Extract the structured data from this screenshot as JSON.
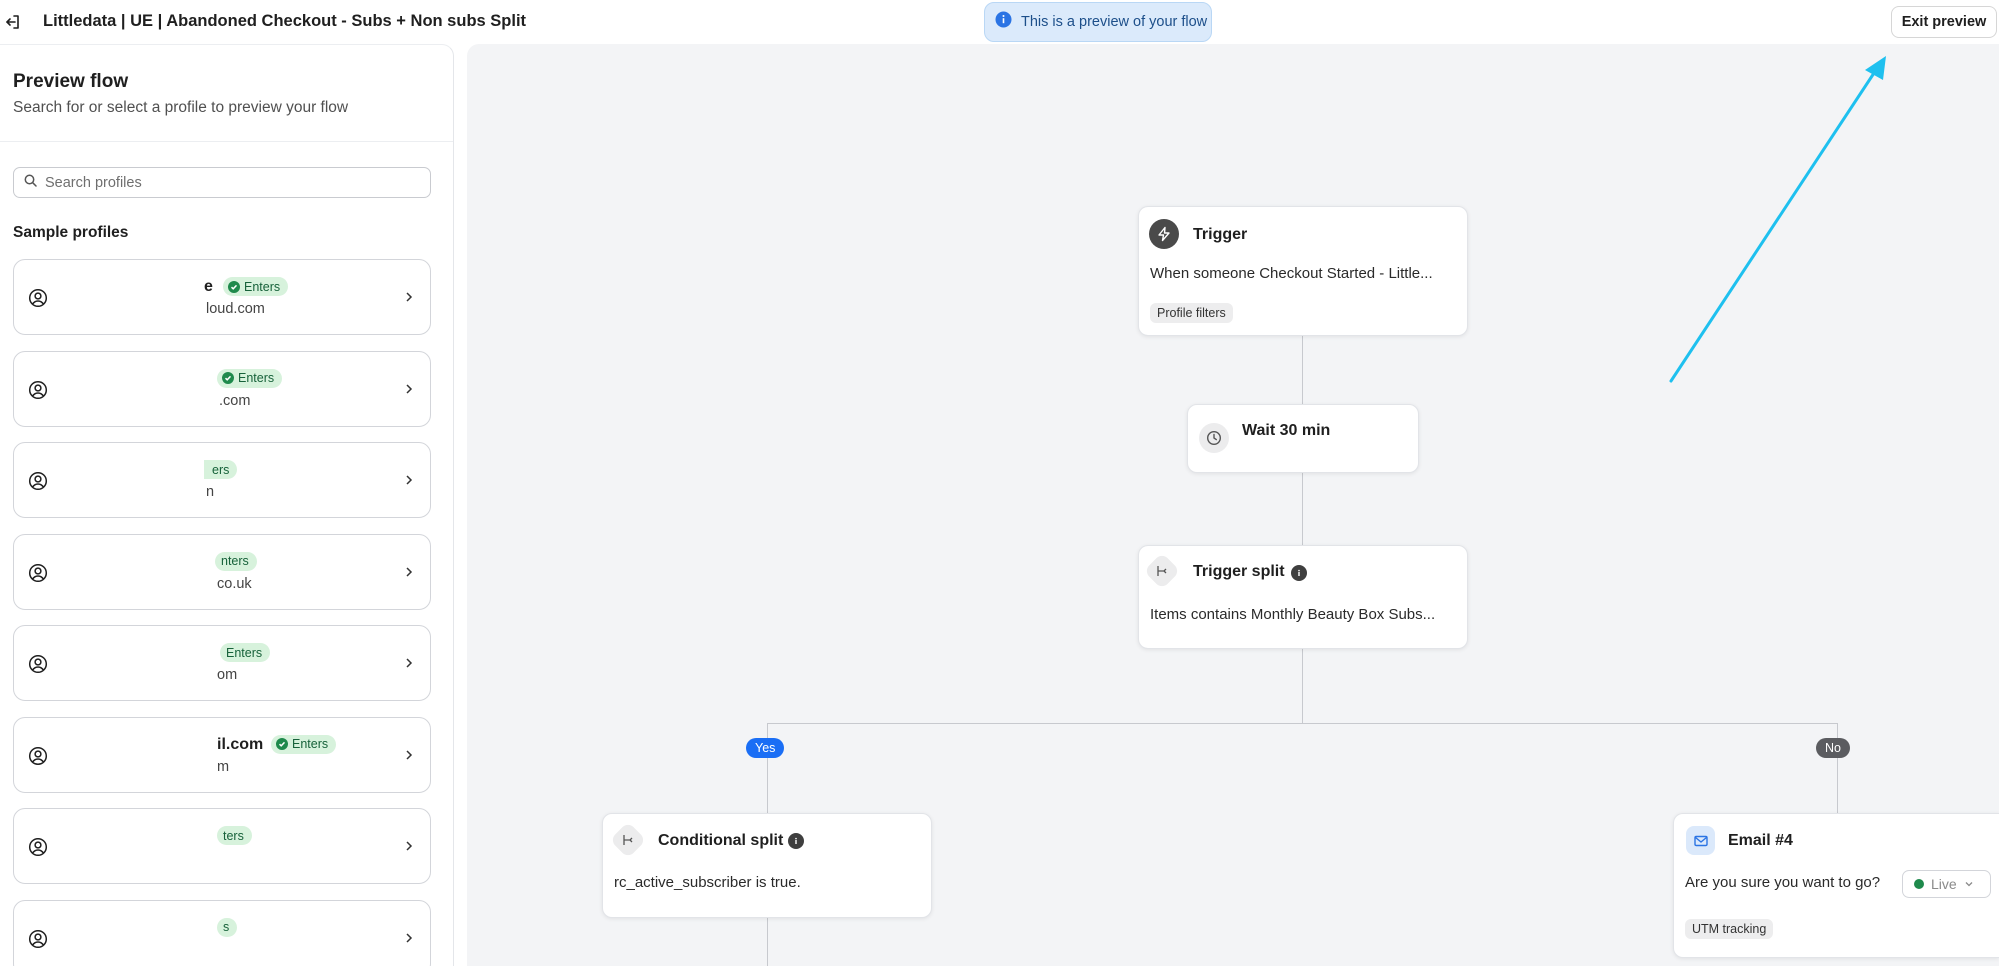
{
  "header": {
    "title": "Littledata | UE | Abandoned Checkout - Subs + Non subs Split",
    "preview_banner": "This is a preview of your flow",
    "exit_button": "Exit preview"
  },
  "sidebar": {
    "title": "Preview flow",
    "subtitle": "Search for or select a profile to preview your flow",
    "search_placeholder": "Search profiles",
    "sample_heading": "Sample profiles",
    "profiles": [
      {
        "name": "e",
        "email": "loud.com",
        "badge": "Enters"
      },
      {
        "name": "",
        "email": ".com",
        "badge": "Enters"
      },
      {
        "name": "",
        "email": "n",
        "badge": "ers"
      },
      {
        "name": "",
        "email": "co.uk",
        "badge": "nters"
      },
      {
        "name": "",
        "email": "om",
        "badge": "Enters"
      },
      {
        "name": "il.com",
        "email": "m",
        "badge": "Enters"
      },
      {
        "name": "",
        "email": "",
        "badge": "ters"
      },
      {
        "name": "",
        "email": "",
        "badge": "s"
      }
    ]
  },
  "flow": {
    "trigger": {
      "title": "Trigger",
      "description": "When someone Checkout Started - Little...",
      "tag": "Profile filters"
    },
    "wait": {
      "title": "Wait 30 min"
    },
    "trigger_split": {
      "title": "Trigger split",
      "description": "Items contains Monthly Beauty Box Subs..."
    },
    "branch_yes": "Yes",
    "branch_no": "No",
    "conditional_split": {
      "title": "Conditional split",
      "description": "rc_active_subscriber is true."
    },
    "email": {
      "title": "Email #4",
      "description": "Are you sure you want to go?",
      "tag": "UTM tracking",
      "status": "Live"
    }
  },
  "colors": {
    "accent_blue": "#1a6ef5",
    "enters_badge_bg": "#d7f2dc",
    "arrow_annotation": "#1ec0ef"
  }
}
